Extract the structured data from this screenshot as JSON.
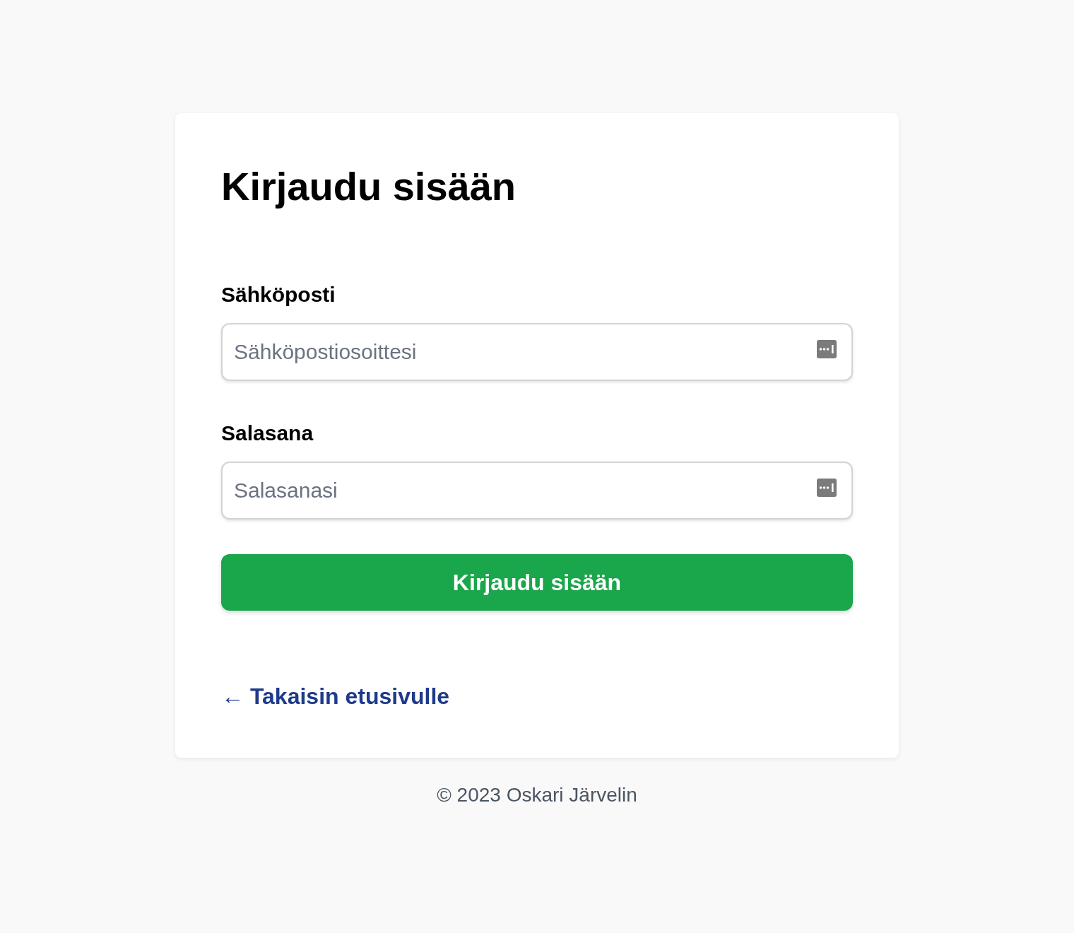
{
  "card": {
    "title": "Kirjaudu sisään",
    "fields": [
      {
        "label": "Sähköposti",
        "placeholder": "Sähköpostiosoittesi"
      },
      {
        "label": "Salasana",
        "placeholder": "Salasanasi"
      }
    ],
    "submit_button": "Kirjaudu sisään",
    "back_link": "← Takaisin etusivulle"
  },
  "footer": "© 2023 Oskari Järvelin"
}
